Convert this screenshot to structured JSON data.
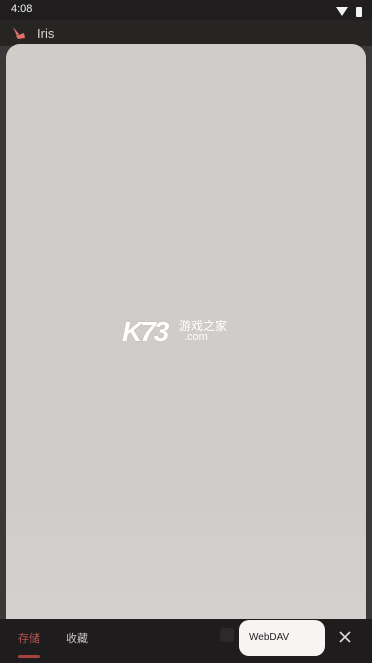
{
  "status_bar": {
    "time": "4:08",
    "icons": [
      "wifi-icon",
      "battery-icon"
    ]
  },
  "app_bar": {
    "title": "Iris",
    "logo": "iris-logo-icon"
  },
  "watermark": {
    "mark": "K73",
    "cn": "游戏之家",
    "domain": ".com"
  },
  "tabs": [
    {
      "label": "存储",
      "active": true
    },
    {
      "label": "收藏",
      "active": false
    }
  ],
  "chip": {
    "label": "WebDAV"
  },
  "close_icon": "close-icon",
  "colors": {
    "accent": "#a6423d",
    "sheet": "#d0ccca",
    "chip": "#f8f4f3"
  }
}
